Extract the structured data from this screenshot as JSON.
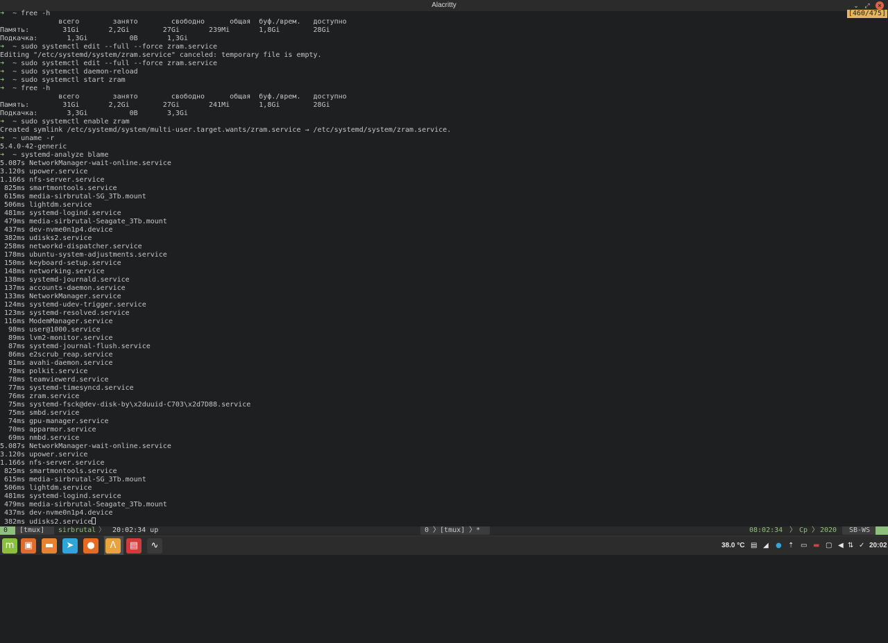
{
  "window": {
    "title": "Alacritty"
  },
  "terminal": {
    "scroll_indicator": "[460/475]",
    "prompt_symbol": "➜",
    "lines": [
      {
        "p": true,
        "t": "  ~ free -h"
      },
      {
        "p": false,
        "t": "              всего        занято        свободно      общая  буф./врем.   доступно"
      },
      {
        "p": false,
        "t": "Память:        31Gi       2,2Gi        27Gi       239Mi       1,8Gi        28Gi"
      },
      {
        "p": false,
        "t": "Подкачка:       1,3Gi          0B       1,3Gi"
      },
      {
        "p": true,
        "t": "  ~ sudo systemctl edit --full --force zram.service"
      },
      {
        "p": false,
        "t": "Editing \"/etc/systemd/system/zram.service\" canceled: temporary file is empty."
      },
      {
        "p": true,
        "t": "  ~ sudo systemctl edit --full --force zram.service"
      },
      {
        "p": true,
        "t": "  ~ sudo systemctl daemon-reload"
      },
      {
        "p": true,
        "t": "  ~ sudo systemctl start zram"
      },
      {
        "p": true,
        "t": "  ~ free -h"
      },
      {
        "p": false,
        "t": "              всего        занято        свободно      общая  буф./врем.   доступно"
      },
      {
        "p": false,
        "t": "Память:        31Gi       2,2Gi        27Gi       241Mi       1,8Gi        28Gi"
      },
      {
        "p": false,
        "t": "Подкачка:       3,3Gi          0B       3,3Gi"
      },
      {
        "p": true,
        "t": "  ~ sudo systemctl enable zram"
      },
      {
        "p": false,
        "t": "Created symlink /etc/systemd/system/multi-user.target.wants/zram.service → /etc/systemd/system/zram.service."
      },
      {
        "p": true,
        "t": "  ~ uname -r"
      },
      {
        "p": false,
        "t": "5.4.0-42-generic"
      },
      {
        "p": true,
        "t": "  ~ systemd-analyze blame"
      },
      {
        "p": false,
        "t": "5.087s NetworkManager-wait-online.service"
      },
      {
        "p": false,
        "t": "3.120s upower.service"
      },
      {
        "p": false,
        "t": "1.166s nfs-server.service"
      },
      {
        "p": false,
        "t": " 825ms smartmontools.service"
      },
      {
        "p": false,
        "t": " 615ms media-sirbrutal-SG_3Tb.mount"
      },
      {
        "p": false,
        "t": " 506ms lightdm.service"
      },
      {
        "p": false,
        "t": " 481ms systemd-logind.service"
      },
      {
        "p": false,
        "t": " 479ms media-sirbrutal-Seagate_3Tb.mount"
      },
      {
        "p": false,
        "t": " 437ms dev-nvme0n1p4.device"
      },
      {
        "p": false,
        "t": " 382ms udisks2.service"
      },
      {
        "p": false,
        "t": " 258ms networkd-dispatcher.service"
      },
      {
        "p": false,
        "t": " 178ms ubuntu-system-adjustments.service"
      },
      {
        "p": false,
        "t": " 150ms keyboard-setup.service"
      },
      {
        "p": false,
        "t": " 148ms networking.service"
      },
      {
        "p": false,
        "t": " 138ms systemd-journald.service"
      },
      {
        "p": false,
        "t": " 137ms accounts-daemon.service"
      },
      {
        "p": false,
        "t": " 133ms NetworkManager.service"
      },
      {
        "p": false,
        "t": " 124ms systemd-udev-trigger.service"
      },
      {
        "p": false,
        "t": " 123ms systemd-resolved.service"
      },
      {
        "p": false,
        "t": " 116ms ModemManager.service"
      },
      {
        "p": false,
        "t": "  98ms user@1000.service"
      },
      {
        "p": false,
        "t": "  89ms lvm2-monitor.service"
      },
      {
        "p": false,
        "t": "  87ms systemd-journal-flush.service"
      },
      {
        "p": false,
        "t": "  86ms e2scrub_reap.service"
      },
      {
        "p": false,
        "t": "  81ms avahi-daemon.service"
      },
      {
        "p": false,
        "t": "  78ms polkit.service"
      },
      {
        "p": false,
        "t": "  78ms teamviewerd.service"
      },
      {
        "p": false,
        "t": "  77ms systemd-timesyncd.service"
      },
      {
        "p": false,
        "t": "  76ms zram.service"
      },
      {
        "p": false,
        "t": "  75ms systemd-fsck@dev-disk-by\\x2duuid-C703\\x2d7D88.service"
      },
      {
        "p": false,
        "t": "  75ms smbd.service"
      },
      {
        "p": false,
        "t": "  74ms gpu-manager.service"
      },
      {
        "p": false,
        "t": "  70ms apparmor.service"
      },
      {
        "p": false,
        "t": "  69ms nmbd.service"
      },
      {
        "p": false,
        "t": "5.087s NetworkManager-wait-online.service"
      },
      {
        "p": false,
        "t": "3.120s upower.service"
      },
      {
        "p": false,
        "t": "1.166s nfs-server.service"
      },
      {
        "p": false,
        "t": " 825ms smartmontools.service"
      },
      {
        "p": false,
        "t": " 615ms media-sirbrutal-SG_3Tb.mount"
      },
      {
        "p": false,
        "t": " 506ms lightdm.service"
      },
      {
        "p": false,
        "t": " 481ms systemd-logind.service"
      },
      {
        "p": false,
        "t": " 479ms media-sirbrutal-Seagate_3Tb.mount"
      },
      {
        "p": false,
        "t": " 437ms dev-nvme0n1p4.device"
      },
      {
        "p": false,
        "t": " 382ms udisks2.service",
        "cursor": true
      }
    ]
  },
  "tmux": {
    "window_index": "0",
    "session": "[tmux]",
    "host": "sirbrutal",
    "separator": "〉",
    "uptime": "20:02:34 up",
    "center": "0 〉[tmux] 〉*",
    "time": "08:02:34",
    "day": "Ср",
    "year": "2020",
    "host_short": "SB-WS"
  },
  "taskbar": {
    "apps": [
      {
        "name": "mint-menu-icon",
        "glyph": "m",
        "color": "#8bbf3f"
      },
      {
        "name": "show-desktop-icon",
        "glyph": "▣",
        "color": "#e06c2c"
      },
      {
        "name": "files-icon",
        "glyph": "▬",
        "color": "#e8822f"
      },
      {
        "name": "telegram-icon",
        "glyph": "➤",
        "color": "#2ea6da"
      },
      {
        "name": "firefox-icon",
        "glyph": "●",
        "color": "#e66a1f"
      },
      {
        "name": "alacritty-icon",
        "glyph": "Λ",
        "color": "#e8a33d"
      },
      {
        "name": "software-center-icon",
        "glyph": "▤",
        "color": "#d23b3b"
      },
      {
        "name": "system-monitor-icon",
        "glyph": "∿",
        "color": "#3a3a3a"
      }
    ],
    "temperature": "38.0 °C",
    "clock": "20:02"
  }
}
